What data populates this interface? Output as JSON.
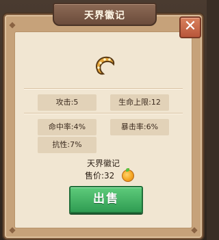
{
  "dialog": {
    "title": "天界徽记",
    "close_glyph": "✕",
    "item_icon": "crescent-badge-icon"
  },
  "stats": {
    "attack": "攻击:5",
    "max_hp": "生命上限:12",
    "hit_rate": "命中率:4%",
    "crit_rate": "暴击率:6%",
    "resistance": "抗性:7%"
  },
  "item": {
    "name": "天界徽记",
    "price_label": "售价:32",
    "currency_icon": "gold-coin-icon"
  },
  "actions": {
    "sell_label": "出售"
  },
  "colors": {
    "title_banner": "#6b4c3b",
    "close_button": "#c0603f",
    "sell_button": "#3aa85a",
    "stat_bg": "#e2d2b8"
  }
}
